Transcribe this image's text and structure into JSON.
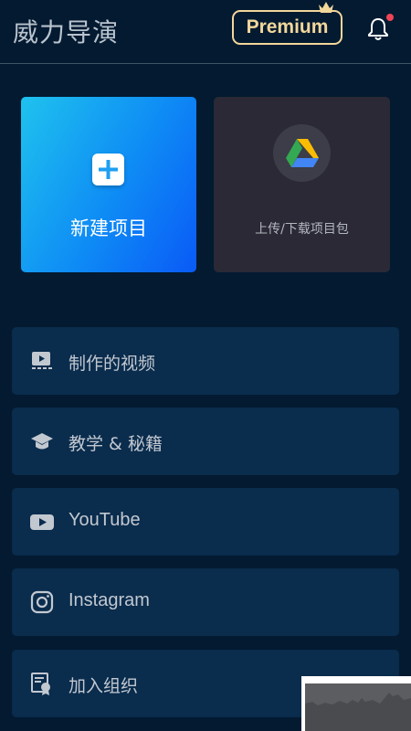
{
  "header": {
    "title": "威力导演",
    "premium_label": "Premium"
  },
  "cards": {
    "new_project_label": "新建项目",
    "drive_label": "上传/下载项目包"
  },
  "menu": [
    {
      "label": "制作的视频",
      "icon": "video-library-icon"
    },
    {
      "label": "教学 & 秘籍",
      "icon": "graduation-cap-icon"
    },
    {
      "label": "YouTube",
      "icon": "youtube-icon"
    },
    {
      "label": "Instagram",
      "icon": "instagram-icon"
    },
    {
      "label": "加入组织",
      "icon": "certificate-icon"
    }
  ],
  "colors": {
    "background": "#031a31",
    "menu_item": "#0a2c4d",
    "premium_gold": "#f2d79b",
    "notification_dot": "#f04455",
    "new_card_gradient": [
      "#1fc2ee",
      "#0a5af6"
    ],
    "drive_card": "#2a2935"
  }
}
